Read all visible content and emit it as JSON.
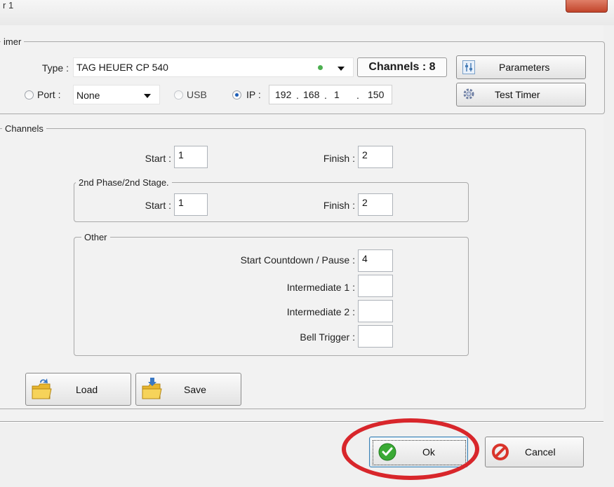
{
  "window": {
    "title_fragment": "r 1"
  },
  "timer_group": {
    "legend": "imer",
    "type_label": "Type :",
    "type_value": "TAG HEUER CP 540",
    "channels_display": "Channels : 8",
    "port_label": "Port :",
    "port_value": "None",
    "usb_label": "USB",
    "ip_label": "IP :",
    "ip_octets": [
      "192",
      "168",
      "1",
      "150"
    ],
    "ip_separator": ".",
    "selected_connection": "IP",
    "parameters_button": "Parameters",
    "test_timer_button": "Test Timer",
    "status_color": "#4caf50"
  },
  "channels_group": {
    "legend": "Channels",
    "start_label": "Start :",
    "start_value": "1",
    "finish_label": "Finish :",
    "finish_value": "2",
    "phase2": {
      "legend": "2nd Phase/2nd Stage.",
      "start_label": "Start :",
      "start_value": "1",
      "finish_label": "Finish :",
      "finish_value": "2"
    },
    "other": {
      "legend": "Other",
      "countdown_label": "Start Countdown / Pause :",
      "countdown_value": "4",
      "intermediate1_label": "Intermediate 1 :",
      "intermediate1_value": "",
      "intermediate2_label": "Intermediate 2 :",
      "intermediate2_value": "",
      "bell_label": "Bell Trigger :",
      "bell_value": ""
    }
  },
  "file_buttons": {
    "load": "Load",
    "save": "Save"
  },
  "dialog_buttons": {
    "ok": "Ok",
    "cancel": "Cancel"
  },
  "colors": {
    "highlight_ellipse": "#d8262b",
    "ok_icon": "#3aaa35",
    "cancel_icon": "#d9342b"
  }
}
